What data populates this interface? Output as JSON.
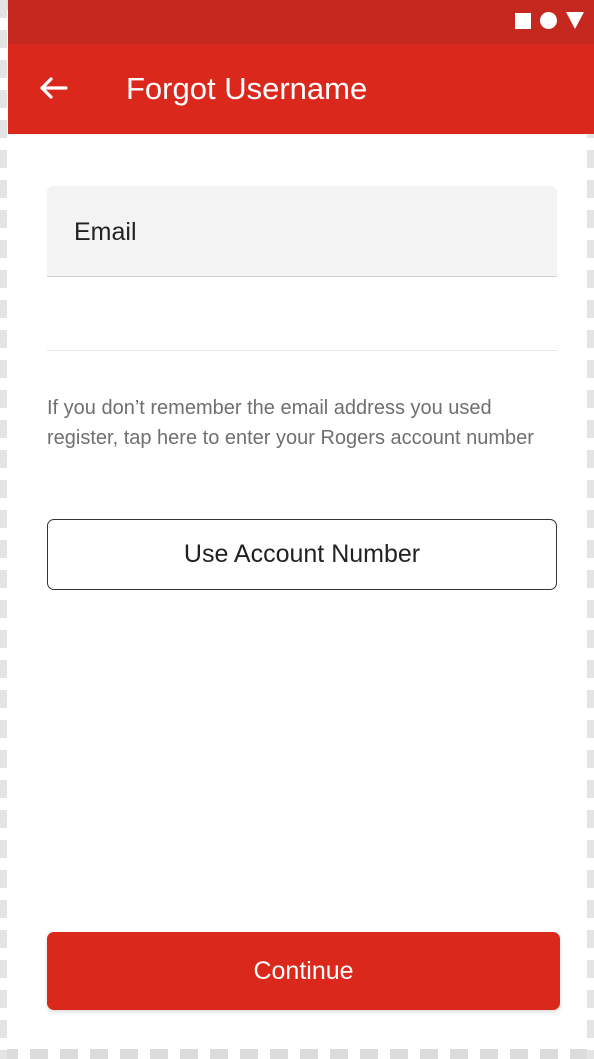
{
  "status_bar": {
    "icons": [
      "square-icon",
      "circle-icon",
      "triangle-icon"
    ],
    "color": "#c5281f"
  },
  "app_bar": {
    "title": "Forgot Username",
    "back_icon": "arrow-left-icon",
    "color": "#da291c"
  },
  "form": {
    "email_label": "Email",
    "email_value": "",
    "help_text": "If you don’t remember the email address you used register, tap here to enter your Rogers account number",
    "use_account_number_label": "Use Account Number",
    "continue_label": "Continue"
  },
  "colors": {
    "brand_red": "#da291c",
    "field_background": "#f3f3f3",
    "help_text": "#6f6f6f"
  }
}
